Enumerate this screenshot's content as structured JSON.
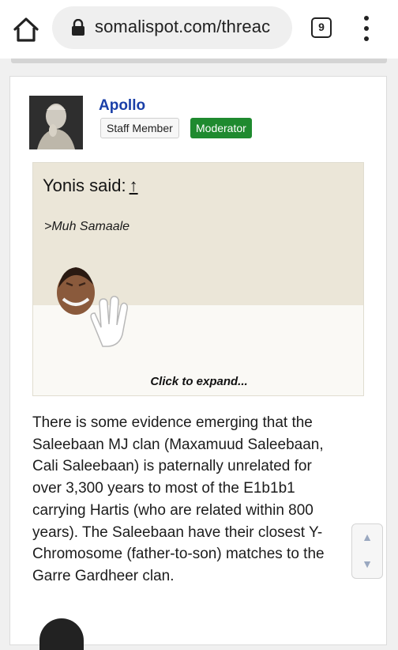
{
  "browser": {
    "url": "somalispot.com/threac",
    "tab_count": "9"
  },
  "post": {
    "username": "Apollo",
    "badges": {
      "staff": "Staff Member",
      "moderator": "Moderator"
    },
    "quote": {
      "author": "Yonis said:",
      "arrow": "↑",
      "text": ">Muh Samaale",
      "expand": "Click to expand..."
    },
    "body_lines": [
      "There is some evidence emerging that the",
      "Saleebaan MJ clan (Maxamuud Saleebaan,",
      "Cali Saleebaan) is paternally unrelated for",
      "over 3,300 years to most of the E1b1b1",
      "carrying Hartis (who are related within 800",
      "years). The Saleebaan have their closest Y-",
      "Chromosome (father-to-son) matches to the",
      "Garre Gardheer clan."
    ]
  },
  "scroll": {
    "up": "▲",
    "down": "▼"
  },
  "colors": {
    "username": "#1a3fa8",
    "moderator_badge": "#1f8a2f",
    "quote_bg": "#ebe6d8"
  }
}
